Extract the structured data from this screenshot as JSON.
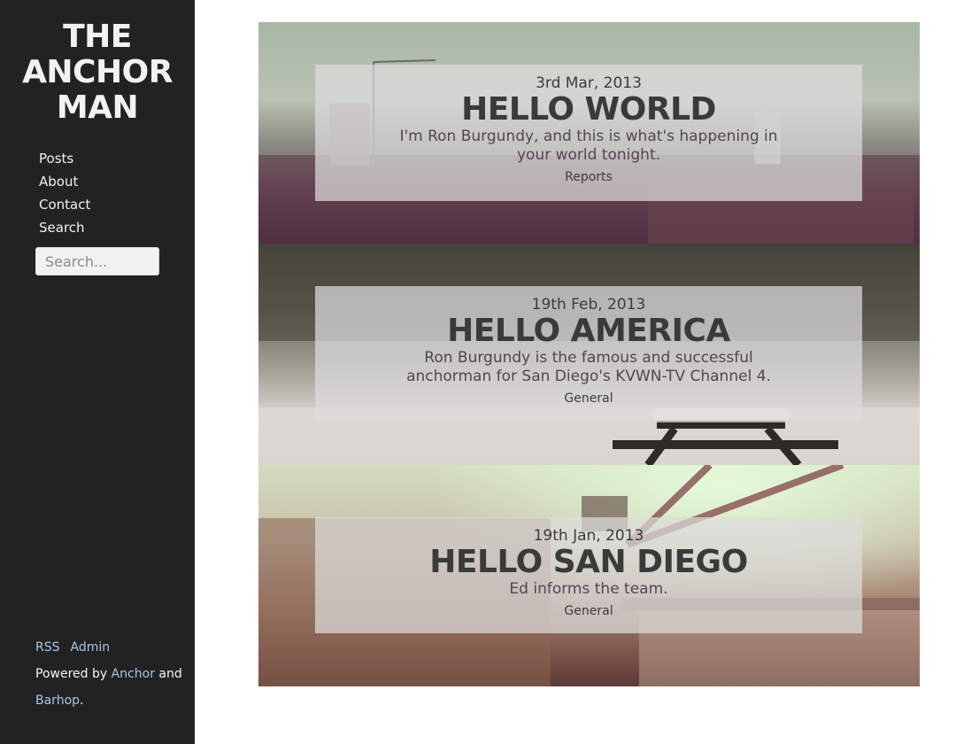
{
  "site": {
    "title_line1": "THE",
    "title_line2": "ANCHOR",
    "title_line3": "MAN"
  },
  "nav": {
    "items": [
      {
        "label": "Posts"
      },
      {
        "label": "About"
      },
      {
        "label": "Contact"
      },
      {
        "label": "Search"
      }
    ]
  },
  "search": {
    "placeholder": "Search..."
  },
  "footer": {
    "rss": "RSS",
    "admin": "Admin",
    "powered_prefix": "Powered by",
    "anchor": "Anchor",
    "and": "and",
    "barhop": "Barhop",
    "period": "."
  },
  "posts": [
    {
      "date": "3rd Mar, 2013",
      "title": "HELLO WORLD",
      "excerpt": "I'm Ron Burgundy, and this is what's happening in your world tonight.",
      "category": "Reports"
    },
    {
      "date": "19th Feb, 2013",
      "title": "HELLO AMERICA",
      "excerpt": "Ron Burgundy is the famous and successful anchorman for San Diego's KVWN-TV Channel 4.",
      "category": "General"
    },
    {
      "date": "19th Jan, 2013",
      "title": "HELLO SAN DIEGO",
      "excerpt": "Ed informs the team.",
      "category": "General"
    }
  ],
  "colors": {
    "sidebar_bg": "#222222",
    "link": "#a9c6e8",
    "card_overlay": "rgba(220,220,220,0.72)",
    "title_text": "#3a3a3a"
  }
}
